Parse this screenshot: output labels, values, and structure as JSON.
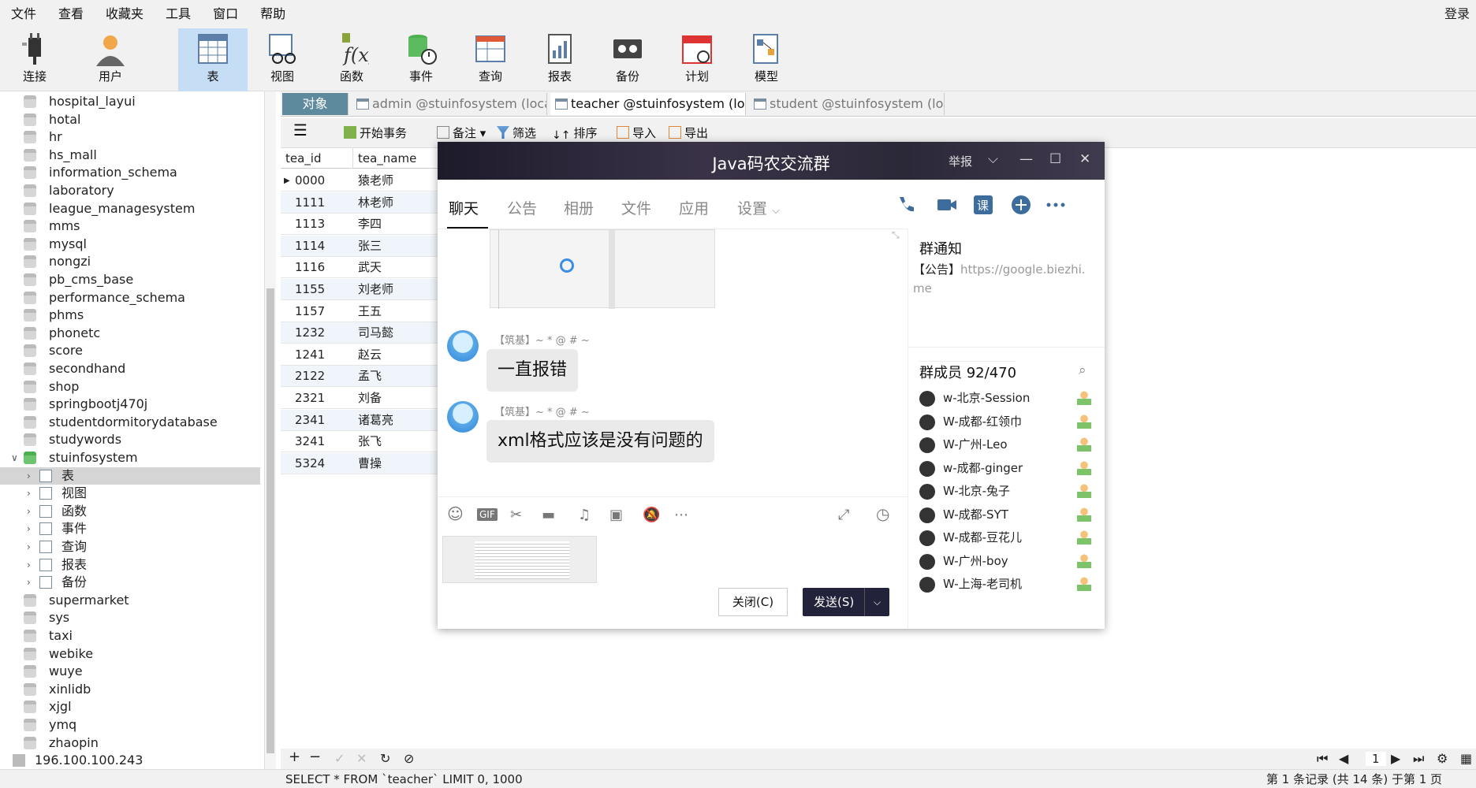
{
  "menu": {
    "items": [
      "文件",
      "查看",
      "收藏夹",
      "工具",
      "窗口",
      "帮助"
    ],
    "login": "登录"
  },
  "toolbar": {
    "items": [
      "连接",
      "用户",
      "表",
      "视图",
      "函数",
      "事件",
      "查询",
      "报表",
      "备份",
      "计划",
      "模型"
    ],
    "active": "表"
  },
  "tree": {
    "items": [
      {
        "label": "hospital_layui",
        "level": 1
      },
      {
        "label": "hotal",
        "level": 1
      },
      {
        "label": "hr",
        "level": 1
      },
      {
        "label": "hs_mall",
        "level": 1
      },
      {
        "label": "information_schema",
        "level": 1
      },
      {
        "label": "laboratory",
        "level": 1
      },
      {
        "label": "league_managesystem",
        "level": 1
      },
      {
        "label": "mms",
        "level": 1
      },
      {
        "label": "mysql",
        "level": 1
      },
      {
        "label": "nongzi",
        "level": 1
      },
      {
        "label": "pb_cms_base",
        "level": 1
      },
      {
        "label": "performance_schema",
        "level": 1
      },
      {
        "label": "phms",
        "level": 1
      },
      {
        "label": "phonetc",
        "level": 1
      },
      {
        "label": "score",
        "level": 1
      },
      {
        "label": "secondhand",
        "level": 1
      },
      {
        "label": "shop",
        "level": 1
      },
      {
        "label": "springbootj470j",
        "level": 1
      },
      {
        "label": "studentdormitorydatabase",
        "level": 1
      },
      {
        "label": "studywords",
        "level": 1
      },
      {
        "label": "stuinfosystem",
        "level": 1,
        "open": true
      },
      {
        "label": "表",
        "level": 2,
        "selected": true
      },
      {
        "label": "视图",
        "level": 2
      },
      {
        "label": "函数",
        "level": 2
      },
      {
        "label": "事件",
        "level": 2
      },
      {
        "label": "查询",
        "level": 2
      },
      {
        "label": "报表",
        "level": 2
      },
      {
        "label": "备份",
        "level": 2
      },
      {
        "label": "supermarket",
        "level": 1
      },
      {
        "label": "sys",
        "level": 1
      },
      {
        "label": "taxi",
        "level": 1
      },
      {
        "label": "webike",
        "level": 1
      },
      {
        "label": "wuye",
        "level": 1
      },
      {
        "label": "xinlidb",
        "level": 1
      },
      {
        "label": "xjgl",
        "level": 1
      },
      {
        "label": "ymq",
        "level": 1
      },
      {
        "label": "zhaopin",
        "level": 1
      },
      {
        "label": "196.100.100.243",
        "level": 0
      }
    ]
  },
  "tabs": {
    "object": "对象",
    "items": [
      "admin @stuinfosystem (loca...",
      "teacher @stuinfosystem (loc...",
      "student @stuinfosystem (loc..."
    ]
  },
  "subbar": {
    "begin": "开始事务",
    "note": "备注",
    "filter": "筛选",
    "sort": "排序",
    "import": "导入",
    "export": "导出"
  },
  "grid": {
    "headers": [
      "tea_id",
      "tea_name"
    ],
    "rows": [
      [
        "0000",
        "猿老师"
      ],
      [
        "1111",
        "林老师"
      ],
      [
        "1113",
        "李四"
      ],
      [
        "1114",
        "张三"
      ],
      [
        "1116",
        "武天"
      ],
      [
        "1155",
        "刘老师"
      ],
      [
        "1157",
        "王五"
      ],
      [
        "1232",
        "司马懿"
      ],
      [
        "1241",
        "赵云"
      ],
      [
        "2122",
        "孟飞"
      ],
      [
        "2321",
        "刘备"
      ],
      [
        "2341",
        "诸葛亮"
      ],
      [
        "3241",
        "张飞"
      ],
      [
        "5324",
        "曹操"
      ]
    ]
  },
  "bottom": {
    "page": "1"
  },
  "status": {
    "sql": "SELECT * FROM `teacher` LIMIT 0, 1000",
    "record": "第 1 条记录 (共 14 条) 于第 1 页"
  },
  "qq": {
    "title": "Java码农交流群",
    "report": "举报",
    "nav": [
      "聊天",
      "公告",
      "相册",
      "文件",
      "应用",
      "设置"
    ],
    "messages": [
      {
        "sender": "【筑基】~ * @ # ~",
        "text": "一直报错"
      },
      {
        "sender": "【筑基】~ * @ # ~",
        "text": "xml格式应该是没有问题的"
      }
    ],
    "close_btn": "关闭(C)",
    "send_btn": "发送(S)",
    "notice": {
      "title": "群通知",
      "prefix": "【公告】",
      "url": "https://google.biezhi.me"
    },
    "members": {
      "title": "群成员 92/470",
      "items": [
        "w-北京-Session",
        "W-成都-红领巾",
        "W-广州-Leo",
        "w-成都-ginger",
        "W-北京-兔子",
        "W-成都-SYT",
        "W-成都-豆花儿",
        "W-广州-boy",
        "W-上海-老司机"
      ]
    }
  }
}
